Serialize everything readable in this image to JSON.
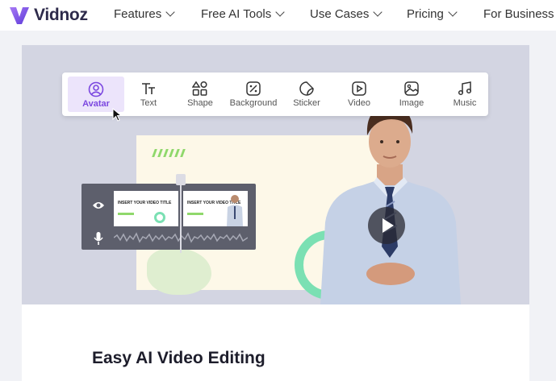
{
  "brand": {
    "name": "Vidnoz",
    "accent": "#7b47e0"
  },
  "nav": {
    "items": [
      {
        "label": "Features",
        "has_dropdown": true
      },
      {
        "label": "Free AI Tools",
        "has_dropdown": true
      },
      {
        "label": "Use Cases",
        "has_dropdown": true
      },
      {
        "label": "Pricing",
        "has_dropdown": true
      },
      {
        "label": "For Business",
        "has_dropdown": false
      }
    ]
  },
  "toolbar": {
    "tools": [
      {
        "label": "Avatar",
        "icon": "avatar-icon",
        "active": true
      },
      {
        "label": "Text",
        "icon": "text-icon",
        "active": false
      },
      {
        "label": "Shape",
        "icon": "shape-icon",
        "active": false
      },
      {
        "label": "Background",
        "icon": "background-icon",
        "active": false
      },
      {
        "label": "Sticker",
        "icon": "sticker-icon",
        "active": false
      },
      {
        "label": "Video",
        "icon": "video-icon",
        "active": false
      },
      {
        "label": "Image",
        "icon": "image-icon",
        "active": false
      },
      {
        "label": "Music",
        "icon": "music-icon",
        "active": false
      }
    ]
  },
  "timeline": {
    "thumb1_title": "INSERT YOUR VIDEO TITLE",
    "thumb2_title": "INSERT YOUR VIDEO TITLE"
  },
  "section": {
    "title": "Easy AI Video Editing"
  }
}
